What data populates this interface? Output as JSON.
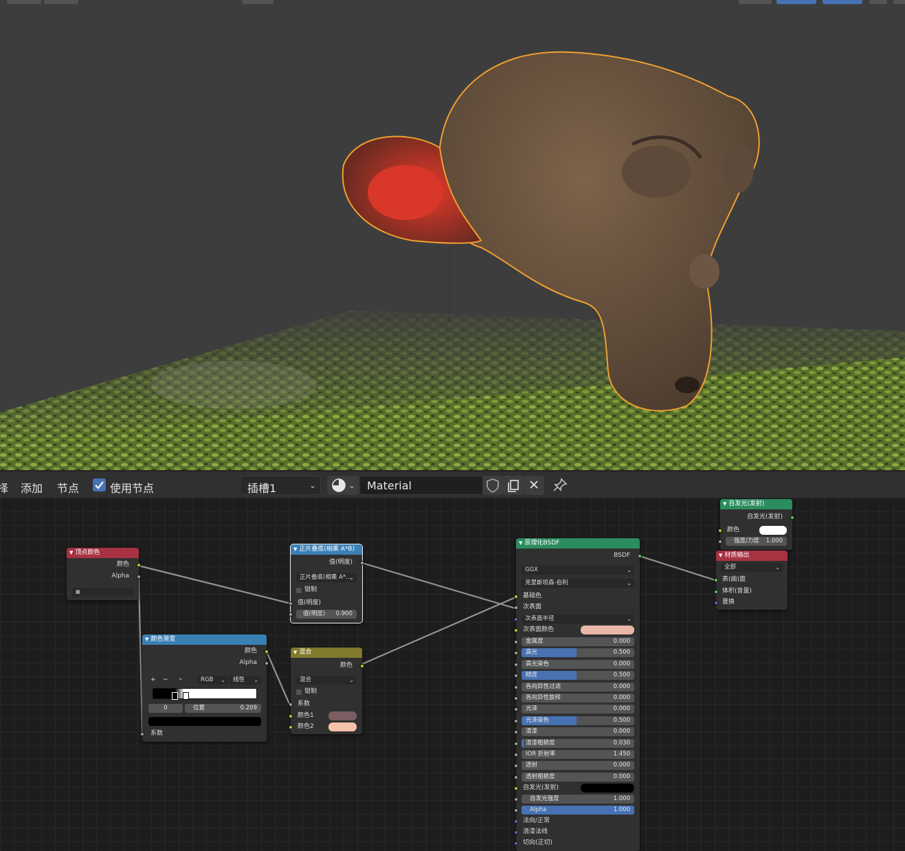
{
  "header": {
    "menu_select_partial": "择",
    "menu_add": "添加",
    "menu_node": "节点",
    "use_nodes_label": "使用节点",
    "slot_label": "插槽1",
    "material_name": "Material"
  },
  "nodes": {
    "vertex_color": {
      "title": "顶点颜色",
      "out_color": "颜色",
      "out_alpha": "Alpha",
      "field": " "
    },
    "color_ramp": {
      "title": "颜色渐变",
      "out_color": "颜色",
      "out_alpha": "Alpha",
      "mode": "RGB",
      "interp": "线性",
      "stop_index": "0",
      "pos_label": "位置",
      "pos_value": "0.209",
      "in_fac": "系数",
      "btn_add": "+",
      "btn_remove": "−",
      "btn_menu": "⌄"
    },
    "multiply": {
      "title": "正片叠底(相乘 A*B)",
      "out_value": "值(明度)",
      "op": "正片叠底(相乘 A*…",
      "clamp": "钳制",
      "in_value1": "值(明度)",
      "in_value2_label": "值(明度)",
      "in_value2": "0.900"
    },
    "mix": {
      "title": "混合",
      "out_color": "颜色",
      "blend": "混合",
      "clamp": "钳制",
      "fac": "系数",
      "color1": "颜色1",
      "color2": "颜色2",
      "color1_hex": "#7a5e62",
      "color2_hex": "#f7c2aa"
    },
    "bsdf": {
      "title": "原理化BSDF",
      "out": "BSDF",
      "distribution": "GGX",
      "subsurface_method": "克里斯坦森-伯利",
      "base_color": "基础色",
      "subsurface": "次表面",
      "subsurface_radius": "次表面半径",
      "subsurface_color": "次表面颜色",
      "subsurface_color_hex": "#e8b7a8",
      "params": [
        {
          "label": "金属度",
          "value": "0.000",
          "fill": 0
        },
        {
          "label": "高光",
          "value": "0.500",
          "fill": 0.5
        },
        {
          "label": "高光染色",
          "value": "0.000",
          "fill": 0
        },
        {
          "label": "糙度",
          "value": "0.500",
          "fill": 0.5
        },
        {
          "label": "各向异性过滤",
          "value": "0.000",
          "fill": 0
        },
        {
          "label": "各向异性旋转",
          "value": "0.000",
          "fill": 0
        },
        {
          "label": "光泽",
          "value": "0.000",
          "fill": 0
        },
        {
          "label": "光泽染色",
          "value": "0.500",
          "fill": 0.5
        },
        {
          "label": "清漆",
          "value": "0.000",
          "fill": 0
        },
        {
          "label": "清漆粗糙度",
          "value": "0.030",
          "fill": 0.03
        },
        {
          "label": "IOR 折射率",
          "value": "1.450",
          "fill": 0
        },
        {
          "label": "透射",
          "value": "0.000",
          "fill": 0
        },
        {
          "label": "透射粗糙度",
          "value": "0.000",
          "fill": 0
        }
      ],
      "emission": "自发光(发射)",
      "emission_hex": "#000000",
      "emission_strength": {
        "label": "自发光强度",
        "value": "1.000"
      },
      "alpha": {
        "label": "Alpha",
        "value": "1.000",
        "fill": 1
      },
      "normal": "法向/正常",
      "clearcoat_normal": "清漆法线",
      "tangent": "切向(正切)"
    },
    "emission": {
      "title": "自发光(发射)",
      "out": "自发光(发射)",
      "color": "颜色",
      "color_hex": "#ffffff",
      "strength_label": "强度/力度",
      "strength": "1.000"
    },
    "output": {
      "title": "材质输出",
      "target": "全部",
      "surface": "表(曲)面",
      "volume": "体积(音量)",
      "displacement": "置换"
    }
  },
  "colors": {
    "accent": "#4772b3",
    "selection_outline": "#f0a030",
    "header_red": "#a83242",
    "header_blue": "#3b80b5",
    "header_olive": "#7f7a2c",
    "header_green": "#2b8c5e"
  }
}
